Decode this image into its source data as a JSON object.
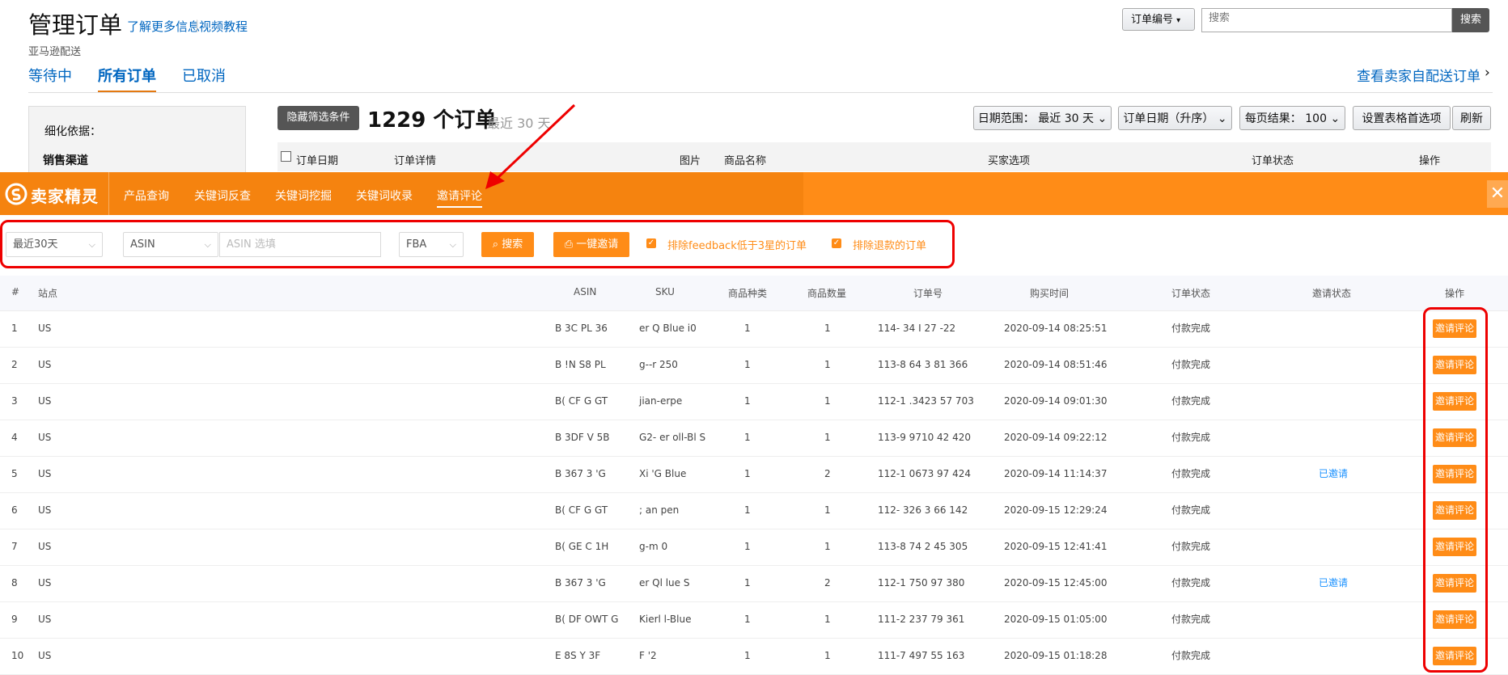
{
  "page": {
    "title": "管理订单",
    "learn_more": "了解更多信息",
    "video": "视频教程",
    "subtitle": "亚马逊配送",
    "tabs": [
      "等待中",
      "所有订单",
      "已取消"
    ],
    "seller_fulfilled": "查看卖家自配送订单",
    "search": {
      "select": "订单编号",
      "placeholder": "搜索",
      "button": "搜索"
    },
    "refine_by": "细化依据：",
    "sales_channel": "销售渠道",
    "hide_filters": "隐藏筛选条件",
    "order_count": "1229 个订单",
    "range": "最近 30 天",
    "date_range": "日期范围： 最近 30 天",
    "order_date_sort": "订单日期（升序）",
    "per_page": "每页结果： 100",
    "table_prefs": "设置表格首选项",
    "refresh": "刷新",
    "columns": [
      "订单日期",
      "订单详情",
      "图片",
      "商品名称",
      "买家选项",
      "订单状态",
      "操作"
    ]
  },
  "plugin": {
    "logo": "卖家精灵",
    "nav": [
      "产品查询",
      "关键词反查",
      "关键词挖掘",
      "关键词收录",
      "邀请评论"
    ],
    "close": "✕",
    "filters": {
      "period": "最近30天",
      "field": "ASIN",
      "placeholder": "ASIN 选填",
      "fulfillment": "FBA",
      "search": "搜索",
      "invite_all": "一键邀请",
      "exclude_low_feedback": "排除feedback低于3星的订单",
      "exclude_refund": "排除退款的订单"
    },
    "headers": {
      "num": "#",
      "site": "站点",
      "asin": "ASIN",
      "sku": "SKU",
      "types": "商品种类",
      "qty": "商品数量",
      "order": "订单号",
      "time": "购买时间",
      "status": "订单状态",
      "invite_status": "邀请状态",
      "op": "操作"
    },
    "rows": [
      {
        "n": "1",
        "site": "US",
        "asin": "B  3C   PL  36",
        "sku": "er Q  Blue  i0",
        "types": "1",
        "qty": "1",
        "order": "114-    34  I    27    -22",
        "time": "2020-09-14 08:25:51",
        "status": "付款完成",
        "invite": "",
        "op": "邀请评论"
      },
      {
        "n": "2",
        "site": "US",
        "asin": "B  !N  S8  PL",
        "sku": "g--r    250",
        "types": "1",
        "qty": "1",
        "order": "113-8   64  3    81  366",
        "time": "2020-09-14 08:51:46",
        "status": "付款完成",
        "invite": "",
        "op": "邀请评论"
      },
      {
        "n": "3",
        "site": "US",
        "asin": "B(  CF  G   GT",
        "sku": "jian-erpe",
        "types": "1",
        "qty": "1",
        "order": "112-1  .3423    57   703",
        "time": "2020-09-14 09:01:30",
        "status": "付款完成",
        "invite": "",
        "op": "邀请评论"
      },
      {
        "n": "4",
        "site": "US",
        "asin": "B  3DF   V   5B",
        "sku": "G2-  er  oll-Bl  S",
        "types": "1",
        "qty": "1",
        "order": "113-9   9710    42   420",
        "time": "2020-09-14 09:22:12",
        "status": "付款完成",
        "invite": "",
        "op": "邀请评论"
      },
      {
        "n": "5",
        "site": "US",
        "asin": "B  367   3  'G",
        "sku": "Xi  'G  Blue",
        "types": "1",
        "qty": "2",
        "order": "112-1   0673    97   424",
        "time": "2020-09-14 11:14:37",
        "status": "付款完成",
        "invite": "已邀请",
        "op": "邀请评论"
      },
      {
        "n": "6",
        "site": "US",
        "asin": "B(  CF  G   GT",
        "sku": ";  an   pen",
        "types": "1",
        "qty": "1",
        "order": "112-   326  3   66  142",
        "time": "2020-09-15 12:29:24",
        "status": "付款完成",
        "invite": "",
        "op": "邀请评论"
      },
      {
        "n": "7",
        "site": "US",
        "asin": "B(  GE   C   1H",
        "sku": "g-m    0",
        "types": "1",
        "qty": "1",
        "order": "113-8   74   2    45   305",
        "time": "2020-09-15 12:41:41",
        "status": "付款完成",
        "invite": "",
        "op": "邀请评论"
      },
      {
        "n": "8",
        "site": "US",
        "asin": "B  367   3  'G",
        "sku": "er Ql  lue S",
        "types": "1",
        "qty": "2",
        "order": "112-1   750    97   380",
        "time": "2020-09-15 12:45:00",
        "status": "付款完成",
        "invite": "已邀请",
        "op": "邀请评论"
      },
      {
        "n": "9",
        "site": "US",
        "asin": "B(  DF   OWT  G",
        "sku": "Kierl  l-Blue",
        "types": "1",
        "qty": "1",
        "order": "111-2   237     79   361",
        "time": "2020-09-15 01:05:00",
        "status": "付款完成",
        "invite": "",
        "op": "邀请评论"
      },
      {
        "n": "10",
        "site": "US",
        "asin": "E  8S   Y   3F",
        "sku": "F  '2",
        "types": "1",
        "qty": "1",
        "order": "111-7   497     55   163",
        "time": "2020-09-15 01:18:28",
        "status": "付款完成",
        "invite": "",
        "op": "邀请评论"
      }
    ]
  },
  "colors": {
    "accent": "#ff8c17",
    "link": "#0066c0",
    "highlight": "#e00000",
    "invited": "#1890ff"
  }
}
